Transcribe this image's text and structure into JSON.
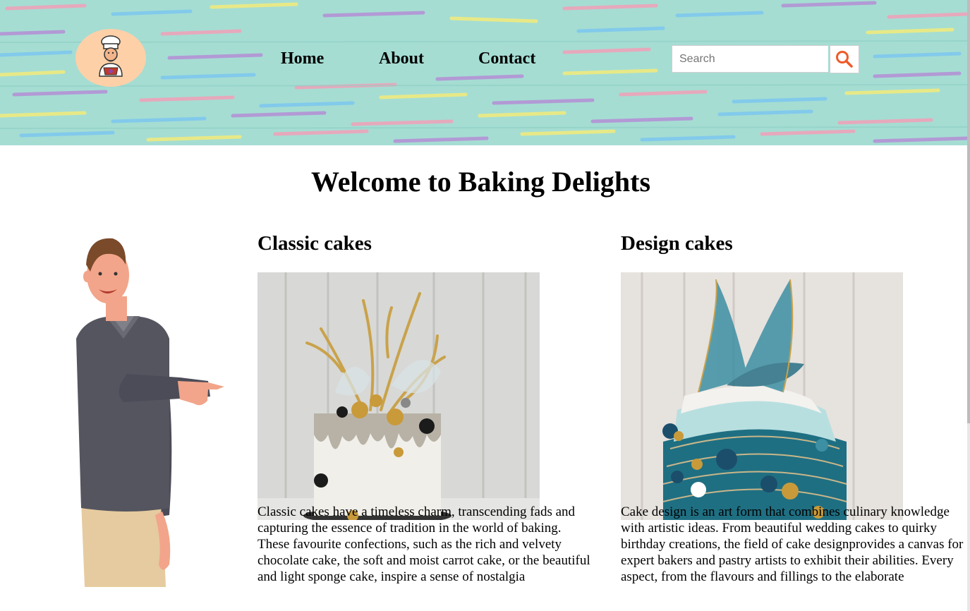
{
  "header": {
    "logo_icon": "chef-baker-icon",
    "nav": [
      {
        "label": "Home"
      },
      {
        "label": "About"
      },
      {
        "label": "Contact"
      }
    ],
    "search": {
      "placeholder": "Search",
      "button_icon": "search-icon"
    },
    "accent_color": "#f05a28",
    "background_color": "#a5ddd3"
  },
  "main": {
    "title": "Welcome to Baking Delights",
    "illustration": "pointing-man-illustration",
    "cards": [
      {
        "heading": "Classic cakes",
        "image": "white-drip-cake-with-gold-sugar-sculpture",
        "text": "Classic cakes have a timeless charm, transcending fads and capturing the essence of tradition in the world of baking. These favourite confections, such as the rich and velvety chocolate cake, the soft and moist carrot cake, or the beautiful and light sponge cake, inspire a sense of nostalgia"
      },
      {
        "heading": "Design cakes",
        "image": "blue-ruffle-cake-with-isomalt-sculpture",
        "text": "Cake design is an art form that combines culinary knowledge with artistic ideas. From beautiful wedding cakes to quirky birthday creations, the field of cake designprovides a canvas for expert bakers and pastry artists to exhibit their abilities. Every aspect, from the flavours and fillings to the elaborate"
      }
    ]
  }
}
